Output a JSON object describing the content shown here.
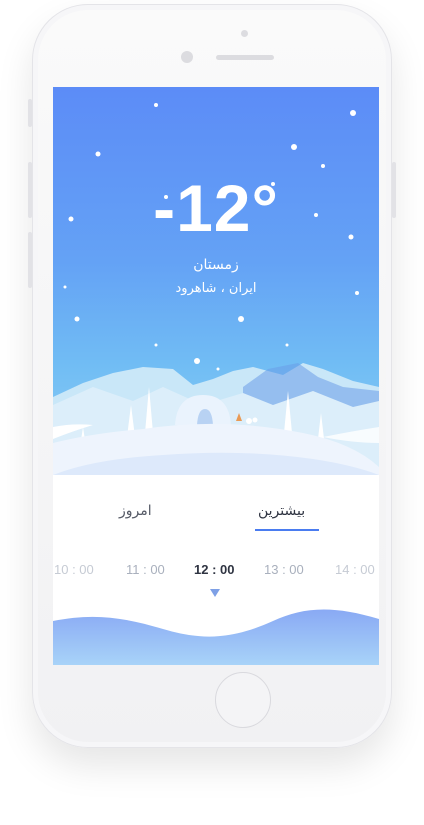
{
  "weather": {
    "temperature": "-12°",
    "season": "زمستان",
    "location": "ایران ، شاهرود"
  },
  "tabs": {
    "today": "امروز",
    "more": "بیشترین"
  },
  "times": [
    "10 : 00",
    "11 : 00",
    "12 : 00",
    "13 : 00",
    "14 : 00"
  ],
  "selected_time_index": 2,
  "colors": {
    "sky_top": "#5c8cf7",
    "sky_bottom": "#8fd0f6",
    "accent": "#4a7cf0",
    "wave": "#8cadf4"
  }
}
